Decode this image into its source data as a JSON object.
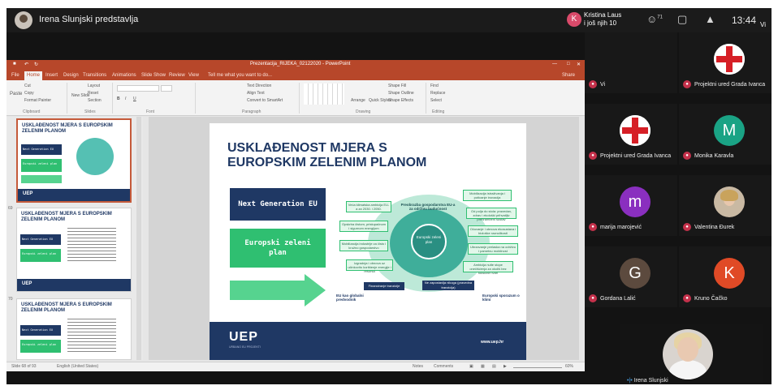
{
  "meeting": {
    "title": "Irena Slunjski predstavlja",
    "speaker": {
      "initial": "K",
      "name": "Kristina Laus",
      "others": "i još njih 10"
    },
    "participant_count": "71",
    "time": "13:44",
    "self_short": "Vi"
  },
  "ppt": {
    "window_title": "Prezentacija_RIJEKA_02122020 - PowerPoint",
    "tabs": [
      "File",
      "Home",
      "Insert",
      "Design",
      "Transitions",
      "Animations",
      "Slide Show",
      "Review",
      "View"
    ],
    "tell_me": "Tell me what you want to do...",
    "share": "Share",
    "ribbon": {
      "cut": "Cut",
      "copy": "Copy",
      "format_painter": "Format Painter",
      "paste": "Paste",
      "new_slide": "New Slide",
      "layout": "Layout",
      "reset": "Reset",
      "section": "Section",
      "text_direction": "Text Direction",
      "align_text": "Align Text",
      "convert": "Convert to SmartArt",
      "arrange": "Arrange",
      "quick_styles": "Quick Styles",
      "shape_fill": "Shape Fill",
      "shape_outline": "Shape Outline",
      "shape_effects": "Shape Effects",
      "find": "Find",
      "replace": "Replace",
      "select": "Select",
      "groups": [
        "Clipboard",
        "Slides",
        "Font",
        "Paragraph",
        "Drawing",
        "Editing"
      ]
    },
    "thumbnails": [
      {
        "number": "",
        "title": "USKLAĐENOST MJERA S EUROPSKIM ZELENIM PLANOM",
        "box1": "Next Generation EU",
        "box2": "Europski zeleni plan",
        "logo": "UEP"
      },
      {
        "number": "69",
        "title": "USKLAĐENOST MJERA S EUROPSKIM ZELENIM PLANOM",
        "box1": "Next Generation EU",
        "box2": "Europski zeleni plan",
        "logo": "UEP"
      },
      {
        "number": "70",
        "title": "USKLAĐENOST MJERA S EUROPSKIM ZELENIM PLANOM",
        "box1": "Next Generation EU",
        "box2": "Europski zeleni plan",
        "logo": ""
      }
    ],
    "slide": {
      "title_line1": "USKLAĐENOST MJERA S",
      "title_line2": "EUROPSKIM ZELENIM PLANOM",
      "box1": "Next Generation EU",
      "box2_line1": "Europski zeleni",
      "box2_line2": "plan",
      "diagram": {
        "core": "Europski zeleni plan",
        "top": "Preobrazba gospodarstva EU-a za održivu budućnost",
        "left": [
          "Veća klimatska ambicija EU-a za 2030. i 2050.",
          "Opskrba čistom, pristupačnom i sigurnom energijom",
          "Mobilizacija industrije za čisto i kružno gospodarstvo",
          "Izgradnja i obnova uz učinkovito korištenje energije i resursa"
        ],
        "right": [
          "Mobilizacija istraživanja i poticanje inovacija",
          "Od polja do stola: pravedan, zdrav i ekološki prihvatljiv prehrambeni sustav",
          "Očuvanje i obnova ekosustava i biološke raznolikosti",
          "Ubrzavanje prelaska na održivu i pametnu mobilnost",
          "Ambicija nulte stope onečišćenja za okoliš bez toksičnih tvari"
        ],
        "bottom": [
          "Financiranje tranzicije",
          "Ne zapostavlja nikoga (pravedna tranzicija)"
        ],
        "label_left": "EU kao globalni predvodnik",
        "label_right": "Europski sporazum o klimi"
      },
      "footer_logo": "UEP",
      "footer_sub": "URBANO EU PROJEKTI",
      "footer_url": "www.uep.hr"
    },
    "status": {
      "slide_info": "Slide 68 of 93",
      "language": "English (United States)",
      "notes": "Notes",
      "comments": "Comments",
      "zoom": "60%"
    }
  },
  "participants": [
    {
      "name": "Vi",
      "type": "empty"
    },
    {
      "name": "Projektni ured Grada Ivanca",
      "type": "cross"
    },
    {
      "name": "Projektni ured Grada Ivanca",
      "type": "cross"
    },
    {
      "name": "Monika Karavla",
      "initial": "M",
      "color": "#1aa385",
      "type": "initial"
    },
    {
      "name": "marija marojević",
      "initial": "m",
      "color": "#8a2fbf",
      "type": "initial"
    },
    {
      "name": "Valentina Đurek",
      "type": "photo"
    },
    {
      "name": "Gordana Lalić",
      "initial": "G",
      "color": "#5c4a3e",
      "type": "initial"
    },
    {
      "name": "Kruno Čačko",
      "initial": "K",
      "color": "#e04a26",
      "type": "initial"
    }
  ],
  "self": {
    "name": "Irena Slunjski"
  }
}
